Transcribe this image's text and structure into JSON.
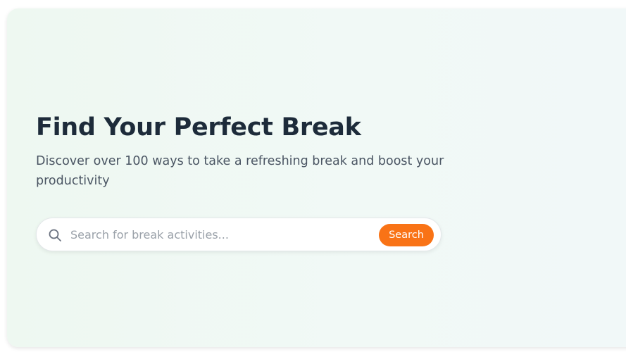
{
  "hero": {
    "title": "Find Your Perfect Break",
    "subtitle": "Discover over 100 ways to take a refreshing break and boost your productivity"
  },
  "search": {
    "icon": "search-icon",
    "placeholder": "Search for break activities...",
    "value": "",
    "button_label": "Search"
  },
  "colors": {
    "accent": "#f97316",
    "title": "#1d2b3a",
    "subtitle": "#4a5563",
    "background": "#eef8f1"
  }
}
